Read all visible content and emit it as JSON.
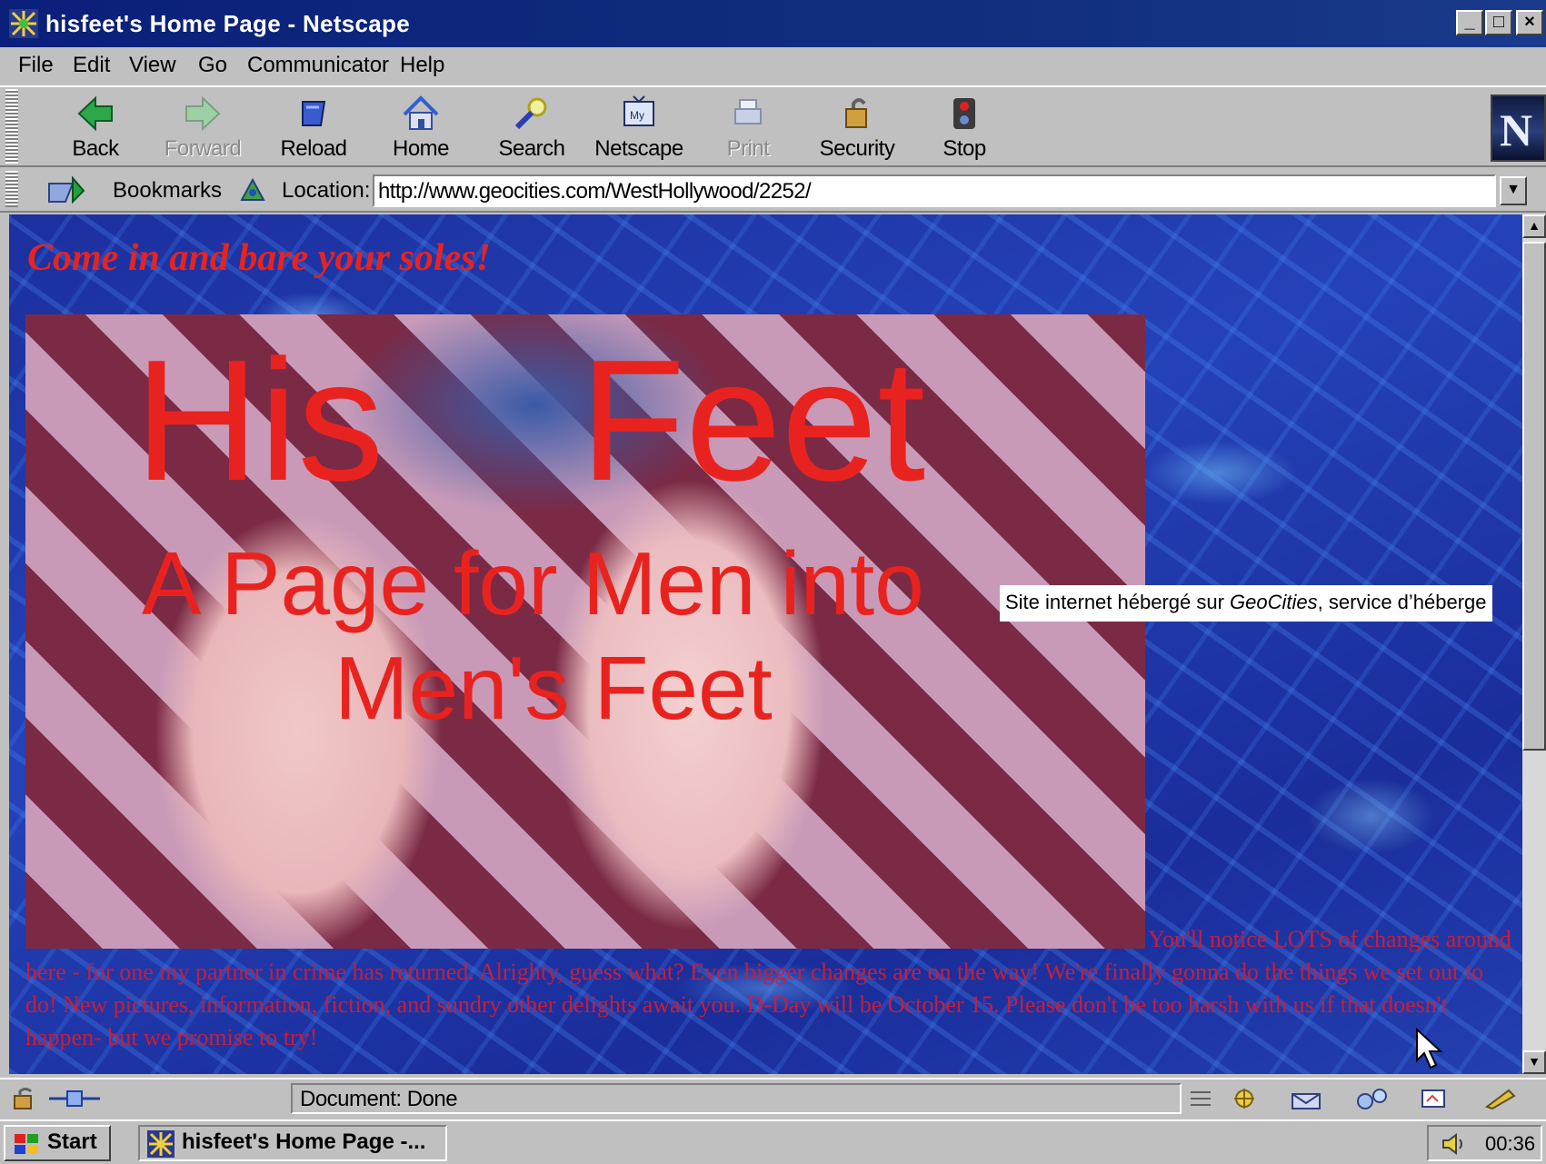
{
  "window": {
    "title": "hisfeet's Home Page - Netscape",
    "minimize": "_",
    "maximize": "□",
    "close": "×"
  },
  "menu": [
    "File",
    "Edit",
    "View",
    "Go",
    "Communicator",
    "Help"
  ],
  "toolbar": {
    "buttons": [
      {
        "label": "Back",
        "icon": "back-arrow-icon",
        "enabled": true
      },
      {
        "label": "Forward",
        "icon": "forward-arrow-icon",
        "enabled": false
      },
      {
        "label": "Reload",
        "icon": "reload-icon",
        "enabled": true
      },
      {
        "label": "Home",
        "icon": "home-icon",
        "enabled": true
      },
      {
        "label": "Search",
        "icon": "search-icon",
        "enabled": true
      },
      {
        "label": "Netscape",
        "icon": "my-netscape-icon",
        "enabled": true
      },
      {
        "label": "Print",
        "icon": "print-icon",
        "enabled": false
      },
      {
        "label": "Security",
        "icon": "lock-icon",
        "enabled": true
      },
      {
        "label": "Stop",
        "icon": "stop-icon",
        "enabled": true
      }
    ],
    "logo_letter": "N"
  },
  "location_bar": {
    "bookmarks_label": "Bookmarks",
    "location_label": "Location:",
    "url": "http://www.geocities.com/WestHollywood/2252/"
  },
  "page": {
    "tagline": "Come in and bare your soles!",
    "hero": {
      "line1_word1": "His",
      "line1_word2": "Feet",
      "line2": "A Page for Men into",
      "line3": "Men's Feet"
    },
    "news": "You'll notice LOTS of changes around here - for one my partner in crime has returned. Alrighty, guess what? Even bigger changes are on the way! We're finally gonna do the things we set out to do! New pictures, information, fiction, and sundry other delights await you. D-Day will be October 15. Please don't be too harsh with us if that doesn't happen- but we promise to try!"
  },
  "caption": {
    "before": "Site internet hébergé sur ",
    "italic": "GeoCities",
    "after": ", service d’héberge"
  },
  "status": {
    "text": "Document: Done"
  },
  "taskbar": {
    "start": "Start",
    "task": "hisfeet's Home Page -...",
    "clock": "00:36"
  },
  "colors": {
    "title_bar": "#0a1f7a",
    "heading_red": "#e8231f",
    "news_text": "#c81e3a",
    "page_background": "#1c2f9e",
    "chrome": "#c0c0c0"
  }
}
